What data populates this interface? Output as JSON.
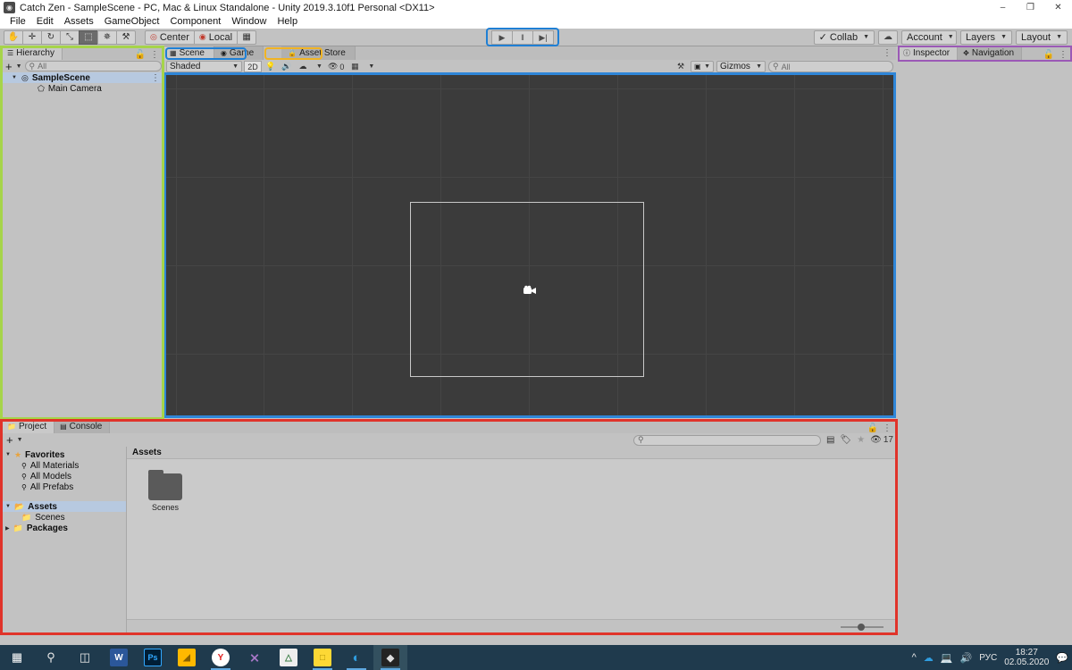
{
  "window": {
    "title": "Catch Zen - SampleScene - PC, Mac & Linux Standalone - Unity 2019.3.10f1 Personal <DX11>",
    "app_icon": "unity-icon",
    "minimize": "–",
    "restore": "❐",
    "close": "✕"
  },
  "menu": {
    "items": [
      "File",
      "Edit",
      "Assets",
      "GameObject",
      "Component",
      "Window",
      "Help"
    ]
  },
  "toolbar": {
    "tools": [
      {
        "name": "hand-tool",
        "glyph": "✋",
        "active": false
      },
      {
        "name": "move-tool",
        "glyph": "✛",
        "active": false
      },
      {
        "name": "rotate-tool",
        "glyph": "↻",
        "active": false
      },
      {
        "name": "scale-tool",
        "glyph": "⤡",
        "active": false
      },
      {
        "name": "rect-tool",
        "glyph": "⬚",
        "active": true
      },
      {
        "name": "transform-tool",
        "glyph": "✵",
        "active": false
      },
      {
        "name": "custom-editor-tool",
        "glyph": "⚒",
        "active": false
      }
    ],
    "pivot_mode": "Center",
    "pivot_rotation": "Local",
    "snap_icon": "grid-snap-icon",
    "play": "▶",
    "pause": "‖",
    "step": "▶|",
    "collab": "Collab",
    "cloud_icon": "cloud-icon",
    "account": "Account",
    "layers": "Layers",
    "layout": "Layout"
  },
  "hierarchy": {
    "tab_label": "Hierarchy",
    "tab_icon": "hierarchy-icon",
    "lock_icon": "lock-icon",
    "menu_icon": "kebab-menu-icon",
    "add_label": "+",
    "search_placeholder": "All",
    "search_value": "",
    "rows": [
      {
        "label": "SampleScene",
        "depth": 1,
        "icon": "scene-icon",
        "selected": true,
        "expanded": true,
        "bold": true
      },
      {
        "label": "Main Camera",
        "depth": 2,
        "icon": "gameobject-icon",
        "selected": false,
        "expanded": false,
        "bold": false
      }
    ]
  },
  "scene": {
    "tabs": [
      {
        "label": "Scene",
        "icon": "scene-grid-icon",
        "active": true
      },
      {
        "label": "Game",
        "icon": "game-icon",
        "active": false
      },
      {
        "label": "Asset Store",
        "icon": "store-icon",
        "active": false
      }
    ],
    "toolbar": {
      "draw_mode": "Shaded",
      "mode_2d": "2D",
      "lighting_icon": "lightbulb-icon",
      "audio_icon": "speaker-icon",
      "fx_icon": "effects-icon",
      "fx_caret": "▾",
      "hidden_count": "0",
      "hidden_icon": "eye-off-icon",
      "scene_vis_icon": "scene-visibility-icon",
      "vis_caret": "▾",
      "tools_icon": "tools-icon",
      "camera_icon": "camera-icon",
      "gizmos_label": "Gizmos",
      "search_placeholder": "All",
      "search_value": ""
    },
    "canvas": {
      "camera_gizmo_icon": "camera-gizmo-icon",
      "frustum_label": "camera-frustum"
    }
  },
  "inspector": {
    "tabs": [
      {
        "label": "Inspector",
        "icon": "info-icon",
        "active": true
      },
      {
        "label": "Navigation",
        "icon": "navigation-icon",
        "active": false
      }
    ],
    "lock_icon": "lock-icon",
    "menu_icon": "kebab-menu-icon"
  },
  "project": {
    "tabs": [
      {
        "label": "Project",
        "icon": "folder-icon",
        "active": true
      },
      {
        "label": "Console",
        "icon": "console-icon",
        "active": false
      }
    ],
    "lock_icon": "lock-icon",
    "menu_icon": "kebab-menu-icon",
    "add_label": "+",
    "search_placeholder": "",
    "search_value": "",
    "filter_icons": [
      "type-filter-icon",
      "label-filter-icon",
      "favorite-filter-icon"
    ],
    "hidden_count": "17",
    "hidden_icon": "eye-off-icon",
    "tree": [
      {
        "label": "Favorites",
        "depth": 0,
        "icon": "star-icon",
        "bold": true,
        "expanded": true
      },
      {
        "label": "All Materials",
        "depth": 1,
        "icon": "search-icon",
        "bold": false,
        "expanded": null
      },
      {
        "label": "All Models",
        "depth": 1,
        "icon": "search-icon",
        "bold": false,
        "expanded": null
      },
      {
        "label": "All Prefabs",
        "depth": 1,
        "icon": "search-icon",
        "bold": false,
        "expanded": null
      },
      {
        "label": "",
        "depth": 0,
        "icon": "",
        "bold": false,
        "expanded": null
      },
      {
        "label": "Assets",
        "depth": 0,
        "icon": "folder-open-icon",
        "bold": true,
        "expanded": true,
        "selected": true
      },
      {
        "label": "Scenes",
        "depth": 1,
        "icon": "folder-icon",
        "bold": false,
        "expanded": null
      },
      {
        "label": "Packages",
        "depth": 0,
        "icon": "folder-icon",
        "bold": true,
        "expanded": false
      }
    ],
    "content_header": "Assets",
    "assets": [
      {
        "label": "Scenes",
        "icon": "folder-icon"
      }
    ],
    "zoom_value": "40"
  },
  "taskbar": {
    "items": [
      {
        "name": "start-button",
        "glyph": "⊞",
        "color": "#ffffff",
        "running": false
      },
      {
        "name": "search-icon",
        "glyph": "⚲",
        "color": "#ffffff",
        "running": false
      },
      {
        "name": "task-view-icon",
        "glyph": "❐",
        "color": "#ffffff",
        "running": false
      },
      {
        "name": "word-icon",
        "glyph": "W",
        "color": "#2b579a",
        "running": false
      },
      {
        "name": "photoshop-icon",
        "glyph": "Ps",
        "color": "#001e36",
        "running": false
      },
      {
        "name": "file-explorer-icon",
        "glyph": "὜1",
        "color": "#ffb900",
        "running": false
      },
      {
        "name": "yandex-browser-icon",
        "glyph": "Y",
        "color": "#ffffff",
        "running": true
      },
      {
        "name": "visual-studio-icon",
        "glyph": "∞",
        "color": "#8b4f9f",
        "running": false
      },
      {
        "name": "chart-app-icon",
        "glyph": "Ὄ8",
        "color": "#f2f2f2",
        "running": false
      },
      {
        "name": "sticky-notes-icon",
        "glyph": "◼",
        "color": "#fdd835",
        "running": true
      },
      {
        "name": "edge-browser-icon",
        "glyph": "◑",
        "color": "#0a84d8",
        "running": true
      },
      {
        "name": "unity-icon",
        "glyph": "⬟",
        "color": "#222222",
        "running": true,
        "active": true
      }
    ],
    "tray": {
      "expand_icon": "∧",
      "onedrive_icon": "cloud-icon",
      "network_icon": "network-icon",
      "volume_icon": "speaker-icon",
      "language": "РУС",
      "time": "18:27",
      "date": "02.05.2020",
      "notification_icon": "notification-icon"
    }
  },
  "colors": {
    "highlight_hierarchy": "#a6d44a",
    "highlight_scene": "#2f86d8",
    "highlight_assetstore": "#f0b323",
    "highlight_inspector": "#9b59b6",
    "highlight_project": "#e0332a",
    "editor_bg": "#c2c2c2",
    "scene_bg": "#3b3b3b",
    "taskbar_bg": "#1f3a4d"
  }
}
